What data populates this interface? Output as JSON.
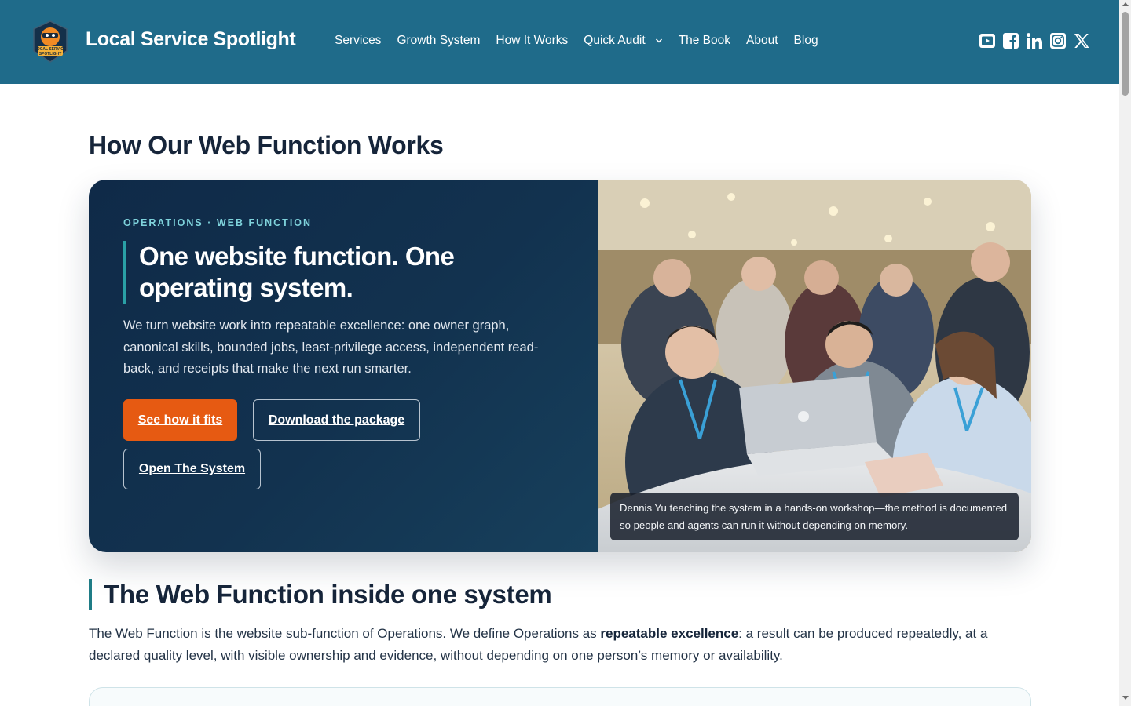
{
  "header": {
    "site_title": "Local Service Spotlight",
    "logo_text": "LOCAL SERVICE SPOTLIGHT",
    "bg_color": "#1f6b8a",
    "nav": [
      {
        "label": "Services"
      },
      {
        "label": "Growth System"
      },
      {
        "label": "How It Works"
      },
      {
        "label": "Quick Audit",
        "has_dropdown": true,
        "icon": "chevron-down-icon"
      },
      {
        "label": "The Book"
      },
      {
        "label": "About"
      },
      {
        "label": "Blog"
      }
    ],
    "socials": [
      "youtube-icon",
      "facebook-icon",
      "linkedin-icon",
      "instagram-icon",
      "x-icon"
    ]
  },
  "main": {
    "page_title": "How Our Web Function Works",
    "hero": {
      "eyebrow": "OPERATIONS · WEB FUNCTION",
      "heading": "One website function. One operating system.",
      "body": "We turn website work into repeatable excellence: one owner graph, canonical skills, bounded jobs, least-privilege access, independent read-back, and receipts that make the next run smarter.",
      "buttons": {
        "primary": "See how it fits",
        "download": "Download the package",
        "system": "Open The System"
      },
      "caption": "Dennis Yu teaching the system in a hands-on workshop—the method is documented so people and agents can run it without depending on memory.",
      "accent_color": "#e65a12"
    },
    "section": {
      "title": "The Web Function inside one system",
      "body_before": "The Web Function is the website sub-function of Operations. We define Operations as ",
      "body_strong": "repeatable excellence",
      "body_after": ": a result can be produced repeatedly, at a declared quality level, with visible ownership and evidence, without depending on one person’s memory or availability."
    }
  }
}
